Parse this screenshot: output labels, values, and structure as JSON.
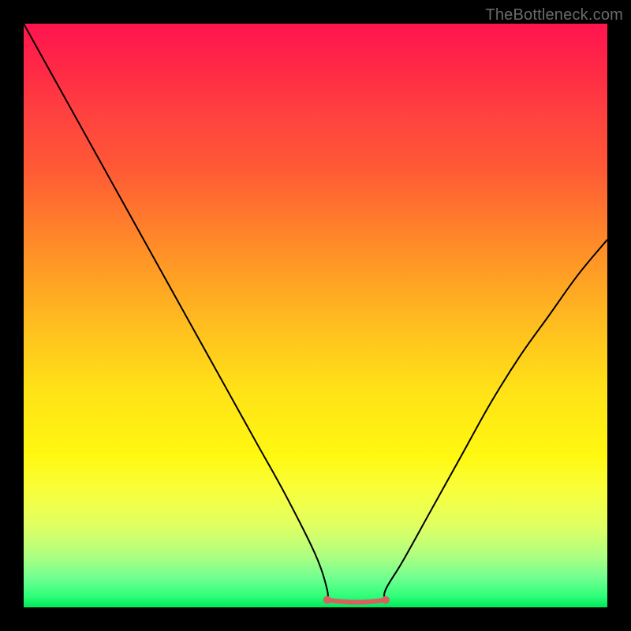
{
  "watermark": "TheBottleneck.com",
  "colors": {
    "background": "#000000",
    "curve": "#000000",
    "flat_segment": "#d86060",
    "gradient_top": "#ff1450",
    "gradient_bottom": "#00e85a"
  },
  "chart_data": {
    "type": "line",
    "title": "",
    "xlabel": "",
    "ylabel": "",
    "xlim": [
      0,
      100
    ],
    "ylim": [
      0,
      100
    ],
    "grid": false,
    "series": [
      {
        "name": "bottleneck-curve",
        "x": [
          0,
          5,
          10,
          15,
          20,
          25,
          30,
          35,
          40,
          45,
          50,
          52,
          55,
          58,
          60,
          62,
          65,
          70,
          75,
          80,
          85,
          90,
          95,
          100
        ],
        "values": [
          100,
          91,
          82,
          73,
          64,
          55,
          46,
          37,
          28,
          19,
          9,
          3,
          1,
          1,
          1,
          3,
          8,
          17,
          26,
          35,
          43,
          50,
          57,
          63
        ]
      }
    ],
    "annotations": [
      {
        "name": "flat-minimum-segment",
        "x_start": 52,
        "x_end": 62,
        "y": 1
      }
    ],
    "background_gradient": "vertical red→yellow→green indicating bottleneck severity"
  }
}
